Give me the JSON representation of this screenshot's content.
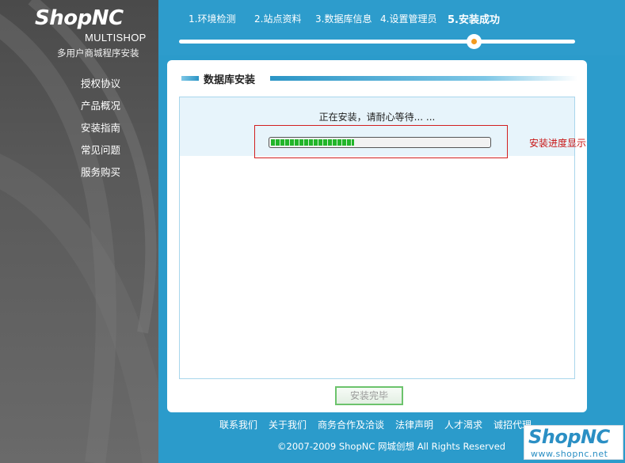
{
  "brand": {
    "logo": "ShopNC",
    "subtitle_en": "MULTISHOP",
    "subtitle_cn": "多用户商城程序安装"
  },
  "sidebar": {
    "items": [
      {
        "label": "授权协议"
      },
      {
        "label": "产品概况"
      },
      {
        "label": "安装指南"
      },
      {
        "label": "常见问题"
      },
      {
        "label": "服务购买"
      }
    ]
  },
  "steps": [
    {
      "label": "1.环境检测",
      "active": false
    },
    {
      "label": "2.站点资料",
      "active": false
    },
    {
      "label": "3.数据库信息",
      "active": false
    },
    {
      "label": "4.设置管理员",
      "active": false
    },
    {
      "label": "5.安装成功",
      "active": true
    }
  ],
  "panel": {
    "title": "数据库安装",
    "install_message": "正在安装，请耐心等待... ...",
    "progress": 0.38,
    "progress_annotation": "安装进度显示",
    "finish_button": "安装完毕"
  },
  "footer": {
    "links": [
      "联系我们",
      "关于我们",
      "商务合作及洽谈",
      "法律声明",
      "人才渴求",
      "诚招代理"
    ],
    "copyright": "©2007-2009 ShopNC 网城创想  All Rights Reserved"
  },
  "corner_logo": {
    "name": "ShopNC",
    "url": "www.shopnc.net"
  },
  "colors": {
    "background": "#2b9bcb",
    "accent": "#f39a1e",
    "progress_green": "#22b52a",
    "annotation_red": "#c81414"
  }
}
